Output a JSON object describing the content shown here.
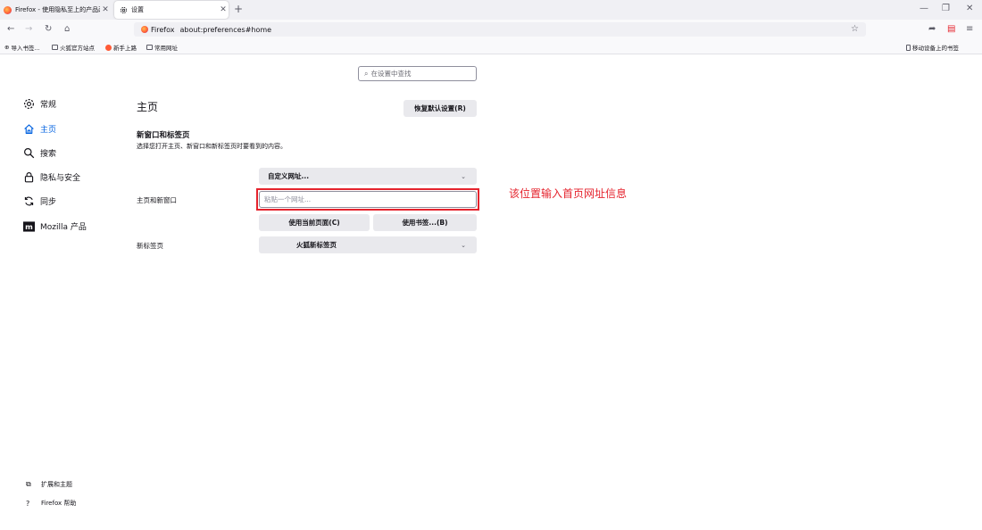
{
  "tabs": [
    {
      "label": "Firefox - 使用隐私至上的产品改",
      "active": false
    },
    {
      "label": "设置",
      "active": true
    }
  ],
  "navbar": {
    "identity_label": "Firefox",
    "url": "about:preferences#home"
  },
  "bookmarks": {
    "items": [
      "导入书签...",
      "火狐官方站点",
      "新手上路",
      "常用网址"
    ],
    "mobile": "移动设备上的书签"
  },
  "search": {
    "placeholder": "在设置中查找"
  },
  "sidebar": {
    "items": [
      {
        "label": "常规",
        "icon": "gear-icon"
      },
      {
        "label": "主页",
        "icon": "home-icon",
        "active": true
      },
      {
        "label": "搜索",
        "icon": "search-icon"
      },
      {
        "label": "隐私与安全",
        "icon": "lock-icon"
      },
      {
        "label": "同步",
        "icon": "sync-icon"
      },
      {
        "label": "Mozilla 产品",
        "icon": "mozilla-icon"
      }
    ],
    "bottom": [
      {
        "label": "扩展和主题",
        "icon": "puzzle-icon"
      },
      {
        "label": "Firefox 帮助",
        "icon": "help-icon"
      }
    ]
  },
  "main": {
    "title": "主页",
    "restore_button": "恢复默认设置(R)",
    "section_title": "新窗口和标签页",
    "section_desc": "选择您打开主页、新窗口和新标签页时要看到的内容。",
    "homepage_select": "自定义网址...",
    "homepage_label": "主页和新窗口",
    "url_placeholder": "粘贴一个网址...",
    "use_current_button": "使用当前页面(C)",
    "use_bookmark_button": "使用书签...(B)",
    "newtab_label": "新标签页",
    "newtab_select": "火狐新标签页"
  },
  "annotation": "该位置输入首页网址信息",
  "colors": {
    "accent": "#0061e0",
    "annotation": "#e5232d"
  }
}
